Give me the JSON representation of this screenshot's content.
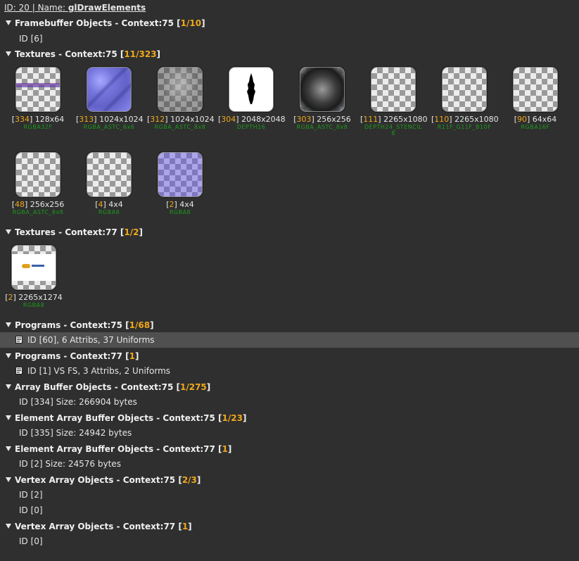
{
  "header": {
    "prefix": "ID: 20 | Name: ",
    "name": "glDrawElements"
  },
  "sections": {
    "fbo": {
      "label": "Framebuffer Objects - Context:75 [",
      "count": "1/10",
      "close": "]",
      "items": [
        "ID [6]"
      ]
    },
    "tex75": {
      "label": "Textures - Context:75 [",
      "count": "11/323",
      "close": "]",
      "items": [
        {
          "id": "334",
          "size": "128x64",
          "format": "RGBA32F"
        },
        {
          "id": "313",
          "size": "1024x1024",
          "format": "RGBA_ASTC_6x6"
        },
        {
          "id": "312",
          "size": "1024x1024",
          "format": "RGBA_ASTC_8x8"
        },
        {
          "id": "304",
          "size": "2048x2048",
          "format": "DEPTH16"
        },
        {
          "id": "303",
          "size": "256x256",
          "format": "RGBA_ASTC_8x8"
        },
        {
          "id": "111",
          "size": "2265x1080",
          "format": "DEPTH24_STENCIL8"
        },
        {
          "id": "110",
          "size": "2265x1080",
          "format": "R11F_G11F_B10F"
        },
        {
          "id": "90",
          "size": "64x64",
          "format": "RGBA16F"
        },
        {
          "id": "48",
          "size": "256x256",
          "format": "RGBA_ASTC_8x8"
        },
        {
          "id": "4",
          "size": "4x4",
          "format": "RGBA8"
        },
        {
          "id": "2",
          "size": "4x4",
          "format": "RGBA8"
        }
      ]
    },
    "tex77": {
      "label": "Textures - Context:77 [",
      "count": "1/2",
      "close": "]",
      "items": [
        {
          "id": "2",
          "size": "2265x1274",
          "format": "RGBA8"
        }
      ]
    },
    "prog75": {
      "label": "Programs - Context:75 [",
      "count": "1/68",
      "close": "]",
      "items": [
        "ID [60], 6 Attribs, 37 Uniforms"
      ]
    },
    "prog77": {
      "label": "Programs - Context:77 [",
      "count": "1",
      "close": "]",
      "items": [
        "ID [1] VS FS, 3 Attribs, 2 Uniforms"
      ]
    },
    "abo75": {
      "label": "Array Buffer Objects - Context:75 [",
      "count": "1/275",
      "close": "]",
      "items": [
        "ID [334] Size: 266904 bytes"
      ]
    },
    "eabo75": {
      "label": "Element Array Buffer Objects - Context:75 [",
      "count": "1/23",
      "close": "]",
      "items": [
        "ID [335] Size: 24942 bytes"
      ]
    },
    "eabo77": {
      "label": "Element Array Buffer Objects - Context:77 [",
      "count": "1",
      "close": "]",
      "items": [
        "ID [2] Size: 24576 bytes"
      ]
    },
    "vao75": {
      "label": "Vertex Array Objects - Context:75 [",
      "count": "2/3",
      "close": "]",
      "items": [
        "ID [2]",
        "ID [0]"
      ]
    },
    "vao77": {
      "label": "Vertex Array Objects - Context:77 [",
      "count": "1",
      "close": "]",
      "items": [
        "ID [0]"
      ]
    }
  },
  "colors": {
    "accent": "#f0a81a",
    "format_green": "#1c9a1c",
    "background": "#2f2f2f",
    "selected_row": "#505050"
  }
}
